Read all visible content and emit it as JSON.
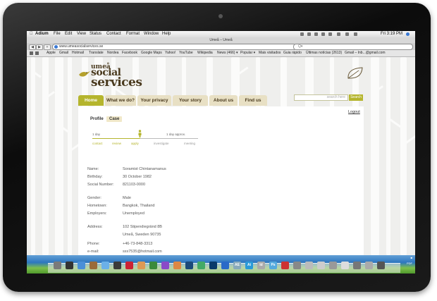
{
  "menubar": {
    "app": "Adium",
    "menus": [
      "File",
      "Edit",
      "View",
      "Status",
      "Contact",
      "Format",
      "Window",
      "Help"
    ],
    "clock": "Fri 3:19 PM"
  },
  "browser": {
    "window_title": "Umeå – Umeå",
    "url": "www.umeasocialservices.se",
    "search_placeholder": "Q▾",
    "back_icon": "back-arrow-icon",
    "forward_icon": "forward-arrow-icon",
    "add_icon": "plus-icon",
    "bookmarks": [
      "Apple",
      "Gmail",
      "Hotmail",
      "Translate",
      "Nordea",
      "Google Maps",
      "Facebook",
      "Google Maps",
      "Yahoo!",
      "YouTube",
      "Wikipedia",
      "News (466) ▾",
      "Popular ▾",
      "Mais visitados",
      "Guia rápido",
      "Últimas notícias (2613)",
      "Gmail – Inb...@gmail.com"
    ]
  },
  "site": {
    "logo": {
      "line1": "umeå",
      "line2": "social",
      "line3": "services"
    },
    "nav": [
      "Home",
      "What we do?",
      "Your privacy",
      "Your story",
      "About us",
      "Find us"
    ],
    "active_nav": "Home",
    "search": {
      "placeholder": "search here",
      "button": "Search"
    },
    "tabs": {
      "profile": "Profile",
      "case": "Case"
    },
    "logout": "Logout",
    "progress": {
      "left_caption": "1 day",
      "right_caption": "1 day approx.",
      "steps": [
        "contact",
        "review",
        "apply",
        "investigate",
        "meeting"
      ],
      "current_step": "apply",
      "completed_fraction": 0.45
    },
    "profile": {
      "name_label": "Name:",
      "name": "Soramist Chintanamanus",
      "birthday_label": "Birthday:",
      "birthday": "30 October 1982",
      "ssn_label": "Social Number:",
      "ssn": "821103-0000",
      "gender_label": "Gender:",
      "gender": "Male",
      "hometown_label": "Hometown:",
      "hometown": "Bangkok, Thailand",
      "employer_label": "Employers:",
      "employer": "Unemployed",
      "address_label": "Address:",
      "address1": "102 Stipendiegränd 8B",
      "address2": "Umeå, Sweden 90735",
      "phone_label": "Phone:",
      "phone": "+46-73-848-3313",
      "email_label": "e-mail:",
      "email": "sxx7535@hotmail.com"
    }
  },
  "dock": {
    "labels": [
      "AE",
      "Ai",
      "Id",
      "Ps",
      "S"
    ],
    "desktop_file": "PDF"
  },
  "colors": {
    "accent": "#b5b52d",
    "brand_brown": "#4a3a1e",
    "tab_beige": "#e8e0c4"
  }
}
